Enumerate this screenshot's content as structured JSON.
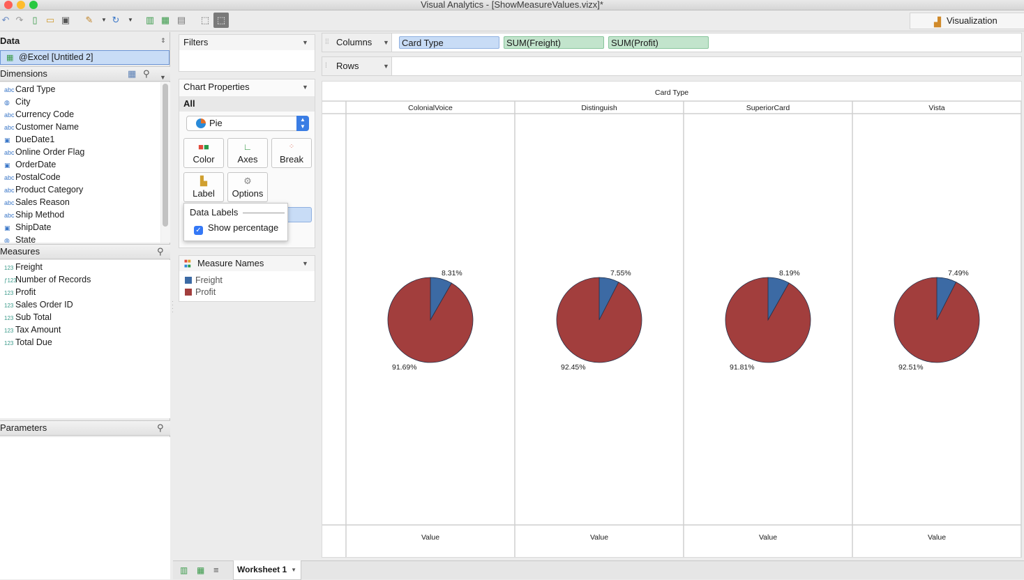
{
  "window": {
    "title": "Visual Analytics - [ShowMeasureValues.vizx]*",
    "traffic_colors": [
      "#fd5f57",
      "#febc2e",
      "#28c840"
    ]
  },
  "toolbar": {
    "visualization_label": "Visualization"
  },
  "data_panel": {
    "title": "Data",
    "source": "@Excel [Untitled 2]"
  },
  "dimensions": {
    "title": "Dimensions",
    "items": [
      {
        "icon": "abc",
        "label": "Card Type"
      },
      {
        "icon": "globe",
        "label": "City"
      },
      {
        "icon": "abc",
        "label": "Currency Code"
      },
      {
        "icon": "abc",
        "label": "Customer Name"
      },
      {
        "icon": "date",
        "label": "DueDate1"
      },
      {
        "icon": "abc",
        "label": "Online Order Flag"
      },
      {
        "icon": "date",
        "label": "OrderDate"
      },
      {
        "icon": "abc",
        "label": "PostalCode"
      },
      {
        "icon": "abc",
        "label": "Product Category"
      },
      {
        "icon": "abc",
        "label": "Sales Reason"
      },
      {
        "icon": "abc",
        "label": "Ship Method"
      },
      {
        "icon": "date",
        "label": "ShipDate"
      },
      {
        "icon": "globe",
        "label": "State"
      }
    ]
  },
  "measures": {
    "title": "Measures",
    "items": [
      {
        "icon": "123",
        "label": "Freight"
      },
      {
        "icon": "f123",
        "label": "Number of Records"
      },
      {
        "icon": "123",
        "label": "Profit"
      },
      {
        "icon": "123",
        "label": "Sales Order ID"
      },
      {
        "icon": "123",
        "label": "Sub Total"
      },
      {
        "icon": "123",
        "label": "Tax Amount"
      },
      {
        "icon": "123",
        "label": "Total Due"
      }
    ]
  },
  "parameters": {
    "title": "Parameters"
  },
  "filters": {
    "title": "Filters"
  },
  "chart_properties": {
    "title": "Chart Properties",
    "scope": "All",
    "chart_type": "Pie",
    "buttons": [
      {
        "name": "color",
        "label": "Color"
      },
      {
        "name": "axes",
        "label": "Axes"
      },
      {
        "name": "break",
        "label": "Break"
      },
      {
        "name": "label",
        "label": "Label"
      },
      {
        "name": "options",
        "label": "Options"
      }
    ]
  },
  "data_labels_popup": {
    "title": "Data Labels",
    "show_percentage_label": "Show percentage",
    "show_percentage_checked": true
  },
  "measure_names": {
    "title": "Measure Names",
    "legend": [
      {
        "label": "Freight",
        "color": "#3c6aa4"
      },
      {
        "label": "Profit",
        "color": "#a23e3d"
      }
    ]
  },
  "shelves": {
    "columns_label": "Columns",
    "rows_label": "Rows",
    "column_pills": [
      {
        "label": "Card Type",
        "kind": "dimension"
      },
      {
        "label": "SUM(Freight)",
        "kind": "measure"
      },
      {
        "label": "SUM(Profit)",
        "kind": "measure"
      }
    ]
  },
  "chart_data": {
    "type": "pie",
    "title": "Card Type",
    "footer_label": "Value",
    "categories": [
      "ColonialVoice",
      "Distinguish",
      "SuperiorCard",
      "Vista"
    ],
    "series": [
      {
        "name": "Freight",
        "color": "#3c6aa4",
        "values": [
          8.31,
          7.55,
          8.19,
          7.49
        ]
      },
      {
        "name": "Profit",
        "color": "#a23e3d",
        "values": [
          91.69,
          92.45,
          91.81,
          92.51
        ]
      }
    ],
    "freight_labels": [
      "8.31%",
      "7.55%",
      "8.19%",
      "7.49%"
    ],
    "profit_labels": [
      "91.69%",
      "92.45%",
      "91.81%",
      "92.51%"
    ]
  },
  "bottom": {
    "worksheet_tab": "Worksheet 1"
  }
}
